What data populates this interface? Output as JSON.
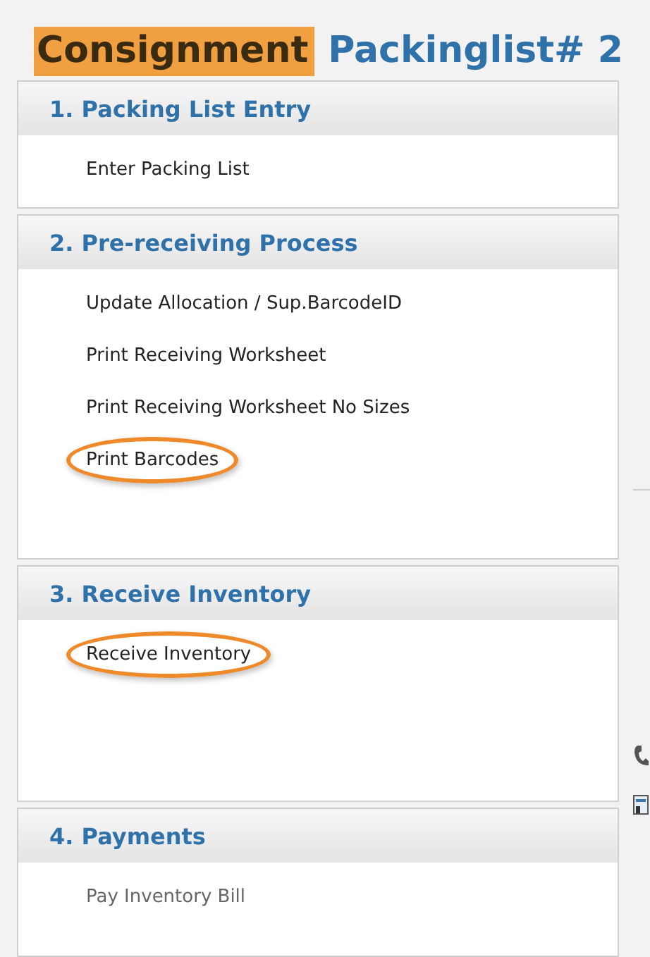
{
  "title": {
    "parts": [
      {
        "text": "Consignment",
        "highlighted": true
      },
      {
        "text": "Packinglist# 2",
        "highlighted": false
      }
    ]
  },
  "sections": [
    {
      "heading": "1. Packing List Entry",
      "items": [
        {
          "label": "Enter Packing List",
          "circled": false,
          "disabled": false
        }
      ]
    },
    {
      "heading": "2. Pre-receiving Process",
      "items": [
        {
          "label": "Update Allocation / Sup.BarcodeID",
          "circled": false,
          "disabled": false
        },
        {
          "label": "Print Receiving Worksheet",
          "circled": false,
          "disabled": false
        },
        {
          "label": "Print Receiving Worksheet No Sizes",
          "circled": false,
          "disabled": false
        },
        {
          "label": "Print Barcodes",
          "circled": true,
          "disabled": false
        }
      ]
    },
    {
      "heading": "3. Receive Inventory",
      "items": [
        {
          "label": "Receive Inventory",
          "circled": true,
          "disabled": false
        }
      ]
    },
    {
      "heading": "4. Payments",
      "items": [
        {
          "label": "Pay Inventory Bill",
          "circled": false,
          "disabled": true
        }
      ]
    }
  ]
}
